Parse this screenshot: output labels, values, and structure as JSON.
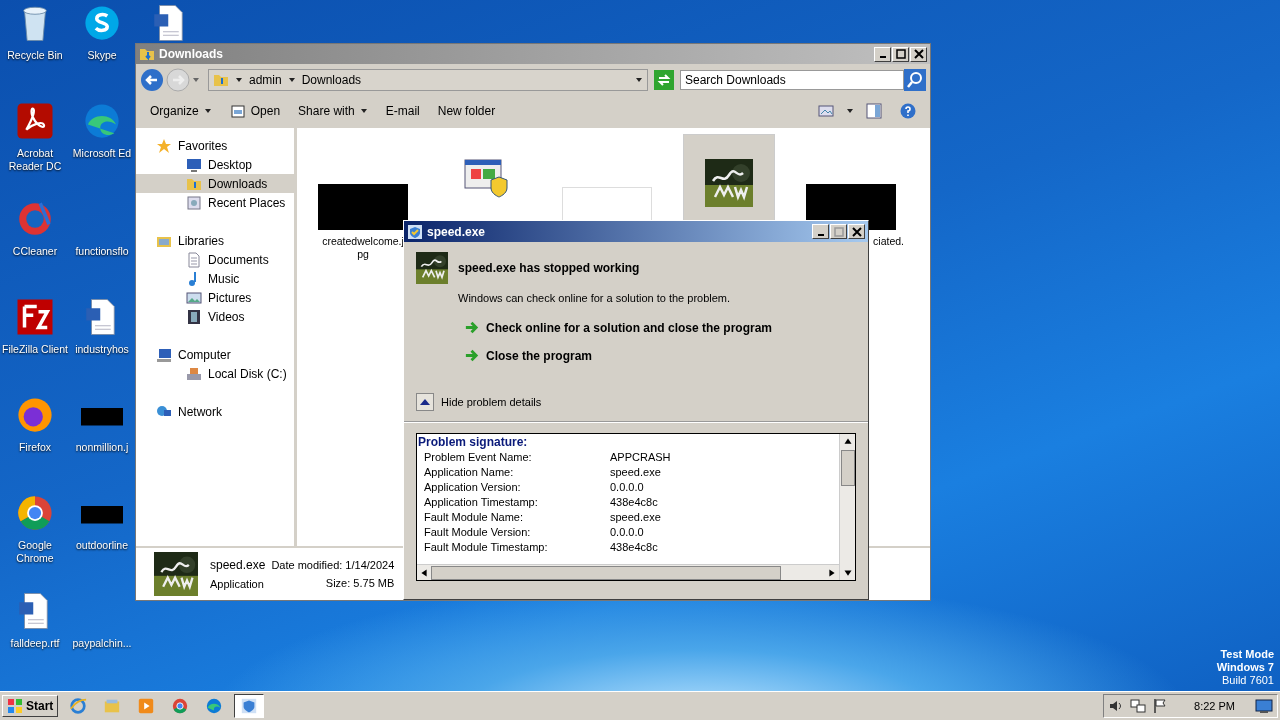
{
  "desktop_icons": [
    {
      "kind": "recycle",
      "label": "Recycle Bin"
    },
    {
      "kind": "acrobat",
      "label": "Acrobat Reader DC"
    },
    {
      "kind": "ccleaner",
      "label": "CCleaner"
    },
    {
      "kind": "filezilla",
      "label": "FileZilla Client"
    },
    {
      "kind": "firefox",
      "label": "Firefox"
    },
    {
      "kind": "chrome",
      "label": "Google Chrome"
    },
    {
      "kind": "doc",
      "label": "falldeep.rtf"
    },
    {
      "kind": "skype",
      "label": "Skype"
    },
    {
      "kind": "edge",
      "label": "Microsoft Ed"
    },
    {
      "kind": "blank",
      "label": "functionsflo"
    },
    {
      "kind": "doc",
      "label": "industryhos"
    },
    {
      "kind": "thumb",
      "label": "nonmillion.j"
    },
    {
      "kind": "thumb",
      "label": "outdoorline"
    },
    {
      "kind": "blank",
      "label": "paypalchin..."
    },
    {
      "kind": "doc"
    }
  ],
  "explorer": {
    "title": "Downloads",
    "breadcrumb": [
      "admin",
      "Downloads"
    ],
    "search": {
      "placeholder": "Search Downloads"
    },
    "toolbar": [
      {
        "label": "Open",
        "kind": "open"
      },
      {
        "label": "Share with",
        "kind": "menu"
      },
      {
        "label": "E-mail",
        "kind": "plain"
      },
      {
        "label": "New folder",
        "kind": "plain"
      }
    ],
    "organize": "Organize",
    "nav": [
      {
        "label": "Favorites",
        "kind": "star",
        "selected": false,
        "children": [
          {
            "label": "Desktop",
            "kind": "desktop",
            "selected": false
          },
          {
            "label": "Downloads",
            "kind": "folder",
            "selected": true
          },
          {
            "label": "Recent Places",
            "kind": "recent",
            "selected": false
          }
        ]
      },
      {
        "label": "Libraries",
        "kind": "library",
        "selected": false,
        "children": [
          {
            "label": "Documents",
            "kind": "document",
            "selected": false
          },
          {
            "label": "Music",
            "kind": "music",
            "selected": false
          },
          {
            "label": "Pictures",
            "kind": "pictures",
            "selected": false
          },
          {
            "label": "Videos",
            "kind": "videos",
            "selected": false
          }
        ]
      },
      {
        "label": "Computer",
        "kind": "computer",
        "selected": false,
        "children": [
          {
            "label": "Local Disk (C:)",
            "kind": "disk",
            "selected": false
          }
        ]
      },
      {
        "label": "Network",
        "kind": "network",
        "selected": false
      }
    ],
    "files": [
      {
        "kind": "thumb",
        "label": "createdwelcome.jpg",
        "selected": false
      },
      {
        "kind": "installer",
        "selected": false
      },
      {
        "kind": "blank",
        "selected": false
      },
      {
        "kind": "app",
        "selected": true
      },
      {
        "kind": "thumb",
        "label": "ciated.",
        "selected": false
      }
    ],
    "details": {
      "name": "speed.exe",
      "type": "Application",
      "date_label": "Date modified:",
      "date": "1/14/2024",
      "size_label": "Size:",
      "size": "5.75 MB"
    }
  },
  "dialog": {
    "title": "speed.exe",
    "heading": "speed.exe has stopped working",
    "message": "Windows can check online for a solution to the problem.",
    "options": [
      "Check online for a solution and close the program",
      "Close the program"
    ],
    "toggle": "Hide problem details",
    "signature_heading": "Problem signature:",
    "signature": [
      {
        "name": "Problem Event Name:",
        "value": "APPCRASH"
      },
      {
        "name": "Application Name:",
        "value": "speed.exe"
      },
      {
        "name": "Application Version:",
        "value": "0.0.0.0"
      },
      {
        "name": "Application Timestamp:",
        "value": "438e4c8c"
      },
      {
        "name": "Fault Module Name:",
        "value": "speed.exe"
      },
      {
        "name": "Fault Module Version:",
        "value": "0.0.0.0"
      },
      {
        "name": "Fault Module Timestamp:",
        "value": "438e4c8c"
      }
    ]
  },
  "os_notice": [
    "Test Mode",
    "Windows 7",
    "Build 7601"
  ],
  "taskbar": {
    "start": "Start",
    "tasks": [
      {
        "kind": "ie",
        "selected": false
      },
      {
        "kind": "explorer",
        "selected": false
      },
      {
        "kind": "media",
        "selected": false
      },
      {
        "kind": "chrome",
        "selected": false
      },
      {
        "kind": "edge",
        "selected": false
      },
      {
        "kind": "crash",
        "selected": true
      }
    ],
    "clock": "8:22 PM"
  }
}
